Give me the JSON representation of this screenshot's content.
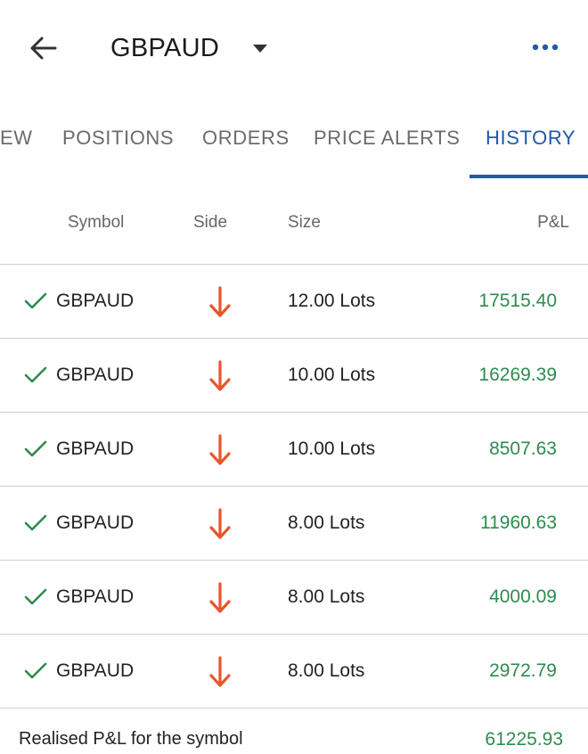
{
  "header": {
    "title": "GBPAUD",
    "back_icon": "arrow-left-icon",
    "dropdown_icon": "caret-down-icon",
    "more_icon": "more-horizontal-icon",
    "more_color": "#1e5aa8"
  },
  "tabs": [
    {
      "label": "EW",
      "active": false
    },
    {
      "label": "POSITIONS",
      "active": false
    },
    {
      "label": "ORDERS",
      "active": false
    },
    {
      "label": "PRICE ALERTS",
      "active": false
    },
    {
      "label": "HISTORY",
      "active": true
    }
  ],
  "table": {
    "columns": {
      "symbol": "Symbol",
      "side": "Side",
      "size": "Size",
      "pnl": "P&L"
    },
    "rows": [
      {
        "symbol": "GBPAUD",
        "side": "sell",
        "size": "12.00 Lots",
        "pnl": "17515.40"
      },
      {
        "symbol": "GBPAUD",
        "side": "sell",
        "size": "10.00 Lots",
        "pnl": "16269.39"
      },
      {
        "symbol": "GBPAUD",
        "side": "sell",
        "size": "10.00 Lots",
        "pnl": "8507.63"
      },
      {
        "symbol": "GBPAUD",
        "side": "sell",
        "size": "8.00 Lots",
        "pnl": "11960.63"
      },
      {
        "symbol": "GBPAUD",
        "side": "sell",
        "size": "8.00 Lots",
        "pnl": "4000.09"
      },
      {
        "symbol": "GBPAUD",
        "side": "sell",
        "size": "8.00 Lots",
        "pnl": "2972.79"
      }
    ]
  },
  "footer": {
    "label": "Realised P&L for the symbol",
    "value": "61225.93"
  },
  "colors": {
    "accent": "#1e5aa8",
    "profit": "#2e8b4f",
    "check": "#2e8b4f",
    "sell_arrow": "#e8562a"
  }
}
